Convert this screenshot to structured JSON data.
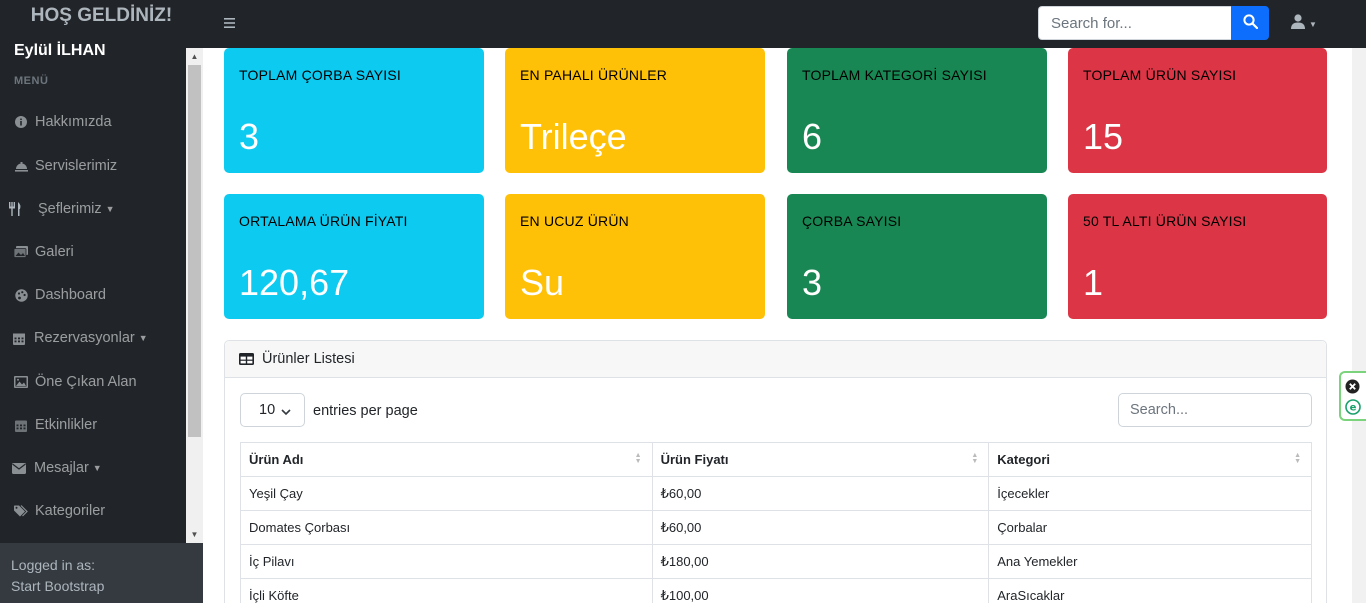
{
  "brand": "HOŞ GELDİNİZ!",
  "topbar": {
    "search_placeholder": "Search for...",
    "toggler_icon": "bars-icon",
    "search_icon": "search-icon",
    "user_icon": "user-icon"
  },
  "sidebar": {
    "user_name": "Eylül İLHAN",
    "menu_heading": "MENÜ",
    "items": [
      {
        "label": "Hakkımızda",
        "icon": "info-circle-icon",
        "dropdown": false
      },
      {
        "label": "Servislerimiz",
        "icon": "bell-concierge-icon",
        "dropdown": false
      },
      {
        "label": "Şeflerimiz",
        "icon": "utensils-icon",
        "dropdown": true
      },
      {
        "label": "Galeri",
        "icon": "images-icon",
        "dropdown": false
      },
      {
        "label": "Dashboard",
        "icon": "palette-icon",
        "dropdown": false
      },
      {
        "label": "Rezervasyonlar",
        "icon": "calendar-icon",
        "dropdown": true
      },
      {
        "label": "Öne Çıkan Alan",
        "icon": "image-icon",
        "dropdown": false
      },
      {
        "label": "Etkinlikler",
        "icon": "calendar-icon",
        "dropdown": false
      },
      {
        "label": "Mesajlar",
        "icon": "envelope-icon",
        "dropdown": true
      },
      {
        "label": "Kategoriler",
        "icon": "tags-icon",
        "dropdown": false
      }
    ],
    "footer_label": "Logged in as:",
    "footer_user": "Start Bootstrap"
  },
  "stats": [
    {
      "title": "TOPLAM ÇORBA SAYISI",
      "value": "3",
      "color": "#0dcaf0"
    },
    {
      "title": "EN PAHALI ÜRÜNLER",
      "value": "Trileçe",
      "color": "#ffc107"
    },
    {
      "title": "TOPLAM KATEGORİ SAYISI",
      "value": "6",
      "color": "#198754"
    },
    {
      "title": "TOPLAM ÜRÜN SAYISI",
      "value": "15",
      "color": "#dc3545"
    },
    {
      "title": "ORTALAMA ÜRÜN FİYATI",
      "value": "120,67",
      "color": "#0dcaf0"
    },
    {
      "title": "EN UCUZ ÜRÜN",
      "value": "Su",
      "color": "#ffc107"
    },
    {
      "title": "ÇORBA SAYISI",
      "value": "3",
      "color": "#198754"
    },
    {
      "title": "50 TL ALTI ÜRÜN SAYISI",
      "value": "1",
      "color": "#dc3545"
    }
  ],
  "table": {
    "header_title": "Ürünler Listesi",
    "header_icon": "table-icon",
    "entries_value": "10",
    "entries_label": "entries per page",
    "search_placeholder": "Search...",
    "columns": [
      "Ürün Adı",
      "Ürün Fiyatı",
      "Kategori"
    ],
    "rows": [
      [
        "Yeşil Çay",
        "₺60,00",
        "İçecekler"
      ],
      [
        "Domates Çorbası",
        "₺60,00",
        "Çorbalar"
      ],
      [
        "İç Pilavı",
        "₺180,00",
        "Ana Yemekler"
      ],
      [
        "İçli Köfte",
        "₺100,00",
        "AraSıcaklar"
      ]
    ]
  },
  "extension": {
    "close_icon": "close-circle-icon",
    "app_icon": "e-circle-icon"
  }
}
